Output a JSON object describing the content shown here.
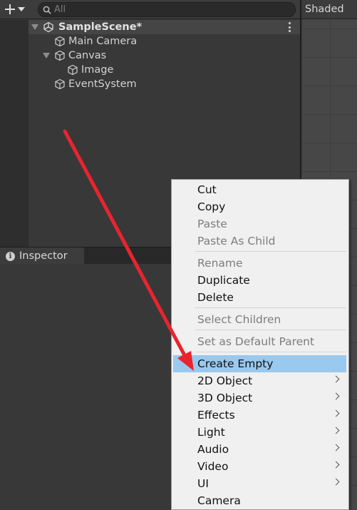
{
  "search": {
    "placeholder": "All"
  },
  "hierarchy": {
    "scene_name": "SampleScene*",
    "items": [
      {
        "label": "Main Camera"
      },
      {
        "label": "Canvas"
      },
      {
        "label": "Image"
      },
      {
        "label": "EventSystem"
      }
    ]
  },
  "scene_view": {
    "shading_mode": "Shaded"
  },
  "inspector": {
    "tab_label": "Inspector"
  },
  "context_menu": {
    "items": [
      {
        "label": "Cut"
      },
      {
        "label": "Copy"
      },
      {
        "label": "Paste"
      },
      {
        "label": "Paste As Child"
      },
      {
        "label": "Rename"
      },
      {
        "label": "Duplicate"
      },
      {
        "label": "Delete"
      },
      {
        "label": "Select Children"
      },
      {
        "label": "Set as Default Parent"
      },
      {
        "label": "Create Empty"
      },
      {
        "label": "2D Object"
      },
      {
        "label": "3D Object"
      },
      {
        "label": "Effects"
      },
      {
        "label": "Light"
      },
      {
        "label": "Audio"
      },
      {
        "label": "Video"
      },
      {
        "label": "UI"
      },
      {
        "label": "Camera"
      }
    ],
    "disabled": [
      "Paste",
      "Paste As Child",
      "Rename",
      "Select Children",
      "Set as Default Parent"
    ],
    "highlighted": "Create Empty",
    "highlight_color": "#99c9ef"
  },
  "annotation": {
    "arrow_color": "#e8242e"
  }
}
